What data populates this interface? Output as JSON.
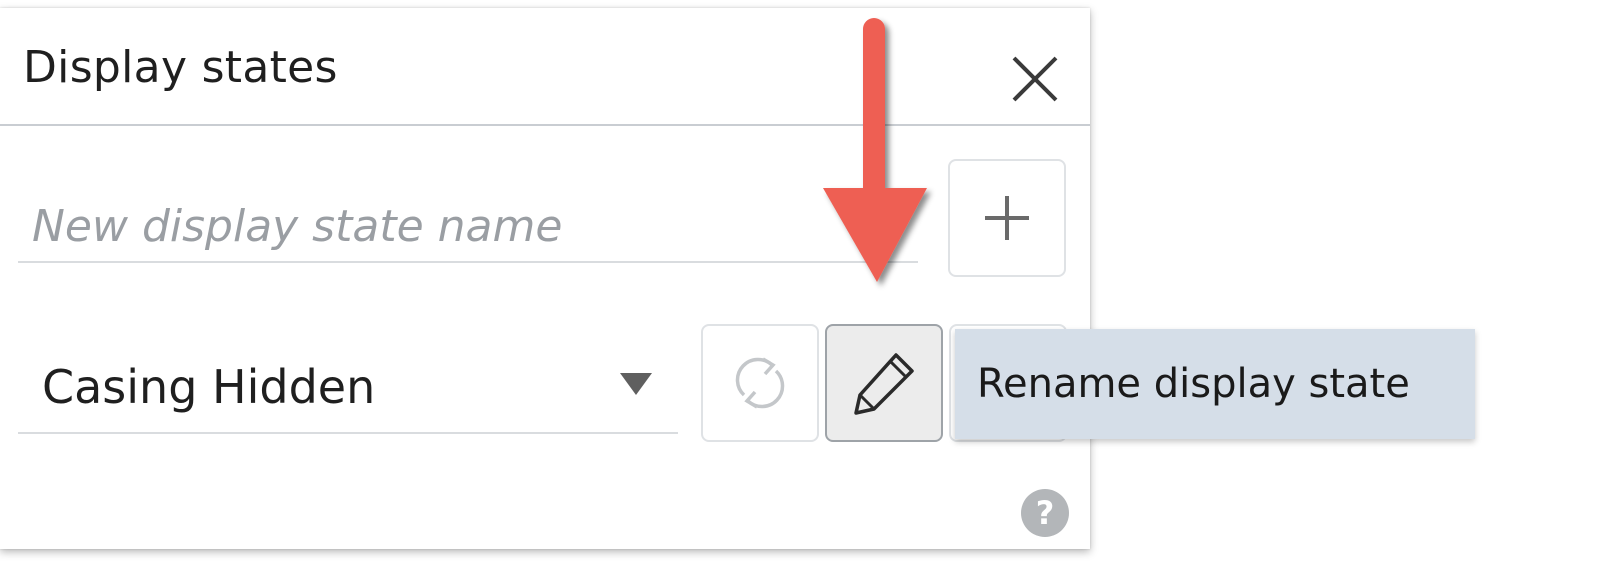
{
  "panel": {
    "title": "Display states",
    "close_icon": "close-icon"
  },
  "new_state": {
    "placeholder": "New display state name",
    "value": "",
    "add_icon": "plus-icon"
  },
  "state_select": {
    "selected": "Casing Hidden",
    "caret_icon": "caret-down-icon"
  },
  "actions": {
    "sync_icon": "refresh-icon",
    "rename_icon": "pencil-icon"
  },
  "tooltip": {
    "text": "Rename display state"
  },
  "help_icon": "help-icon",
  "colors": {
    "annotation_arrow": "#ee5e52",
    "tooltip_bg": "#d5dee8",
    "active_button_bg": "#ececec"
  }
}
